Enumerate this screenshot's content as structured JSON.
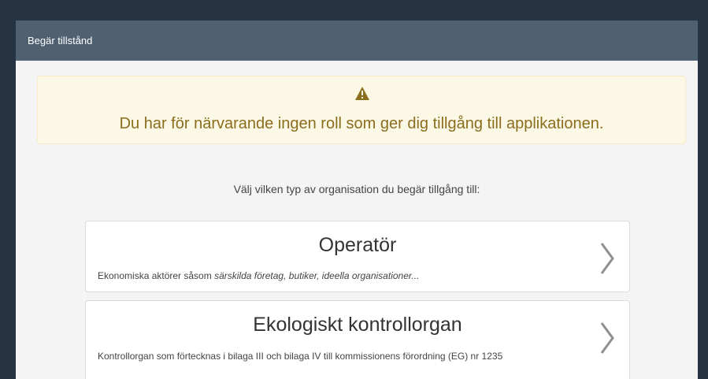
{
  "window": {
    "title": "Begär tillstånd"
  },
  "alert": {
    "icon": "warning-icon",
    "message": "Du har för närvarande ingen roll som ger dig tillgång till applikationen."
  },
  "prompt": "Välj vilken typ av organisation du begär tillgång till:",
  "organizations": [
    {
      "title": "Operatör",
      "description_prefix": "Ekonomiska aktörer såsom ",
      "description_examples": "särskilda företag, butiker, ideella organisationer...",
      "icon": "chevron-right-icon"
    },
    {
      "title": "Ekologiskt kontrollorgan",
      "description_prefix": "Kontrollorgan som förtecknas i bilaga III och bilaga IV till kommissionens förordning (EG) nr 1235",
      "description_examples": "",
      "icon": "chevron-right-icon"
    }
  ],
  "colors": {
    "header_bg": "#4f6071",
    "alert_bg": "#fcf8e6",
    "alert_text": "#8a6d1d",
    "dark_frame": "#263343"
  }
}
